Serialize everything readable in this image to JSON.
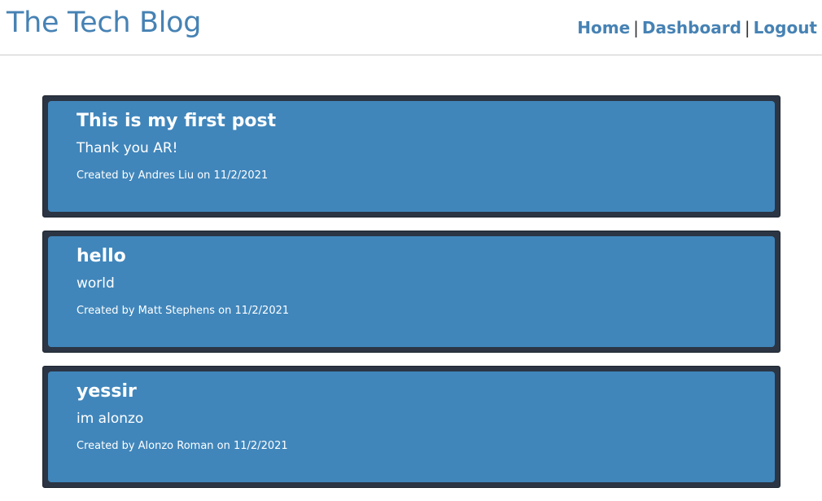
{
  "site": {
    "title": "The Tech Blog"
  },
  "nav": {
    "home": "Home",
    "dashboard": "Dashboard",
    "logout": "Logout",
    "separator": "|"
  },
  "posts": [
    {
      "title": "This is my first post",
      "body": "Thank you AR!",
      "meta": "Created by Andres Liu on 11/2/2021"
    },
    {
      "title": "hello",
      "body": "world",
      "meta": "Created by Matt Stephens on 11/2/2021"
    },
    {
      "title": "yessir",
      "body": "im alonzo",
      "meta": "Created by Alonzo Roman on 11/2/2021"
    }
  ],
  "colors": {
    "accent": "#4682b4",
    "card_border": "#2b3544",
    "card_fill": "#4086bb"
  }
}
